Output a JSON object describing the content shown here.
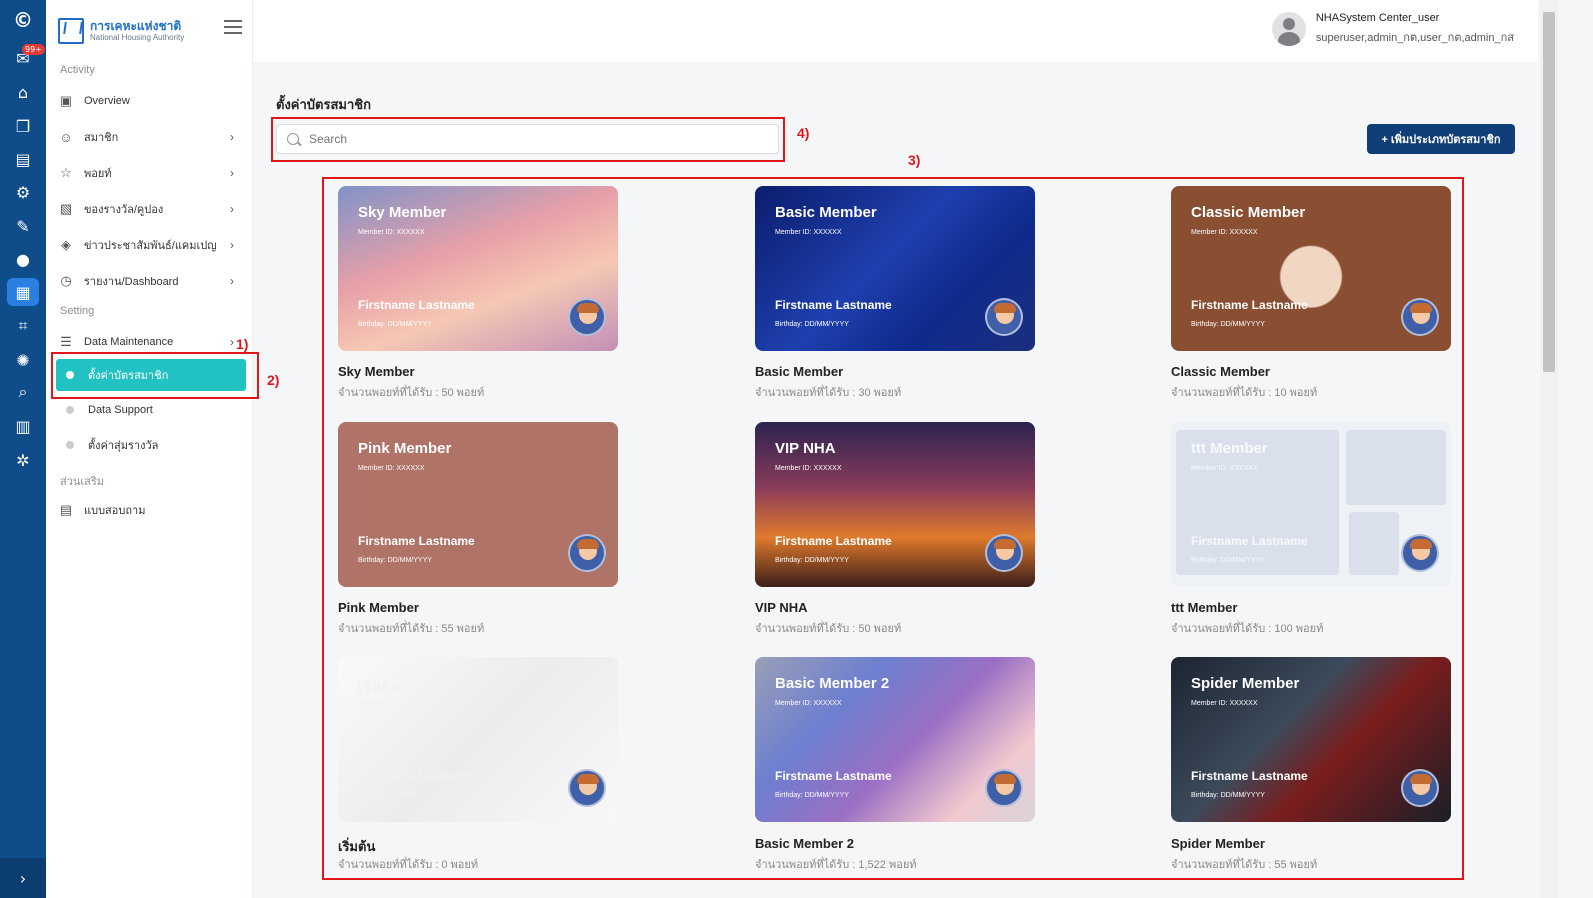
{
  "rail": {
    "badge": "99+",
    "expand_icon": "›"
  },
  "sidebar": {
    "logo_th": "การเคหะแห่งชาติ",
    "logo_en": "National Housing Authority",
    "section_activity": "Activity",
    "items": [
      {
        "label": "Overview"
      },
      {
        "label": "สมาชิก"
      },
      {
        "label": "พอยท์"
      },
      {
        "label": "ของรางวัล/คูปอง"
      },
      {
        "label": "ข่าวประชาสัมพันธ์/แคมเปญ"
      },
      {
        "label": "รายงาน/Dashboard"
      }
    ],
    "section_setting": "Setting",
    "data_maintenance": "Data Maintenance",
    "sub_items": [
      {
        "label": "ตั้งค่าบัตรสมาชิก"
      },
      {
        "label": "Data Support"
      },
      {
        "label": "ตั้งค่าสุ่มรางวัล"
      }
    ],
    "section_extra": "ส่วนเสริม",
    "survey": "แบบสอบถาม"
  },
  "header": {
    "user_name": "NHASystem Center_user",
    "user_roles": "superuser,admin_กต,user_กต,admin_กส"
  },
  "main": {
    "title": "ตั้งค่าบัตรสมาชิก",
    "search_placeholder": "Search",
    "add_button": "+ เพิ่มประเภทบัตรสมาชิก"
  },
  "annotations": [
    "1)",
    "2)",
    "3)",
    "4)"
  ],
  "card_template": {
    "member_id": "Member ID: XXXXXX",
    "name": "Firstname Lastname",
    "birthday": "Birthday: DD/MM/YYYY"
  },
  "cards": [
    {
      "title": "Sky Member",
      "label": "Sky Member",
      "points": "จำนวนพอยท์ที่ได้รับ : 50 พอยท์"
    },
    {
      "title": "Basic Member",
      "label": "Basic Member",
      "points": "จำนวนพอยท์ที่ได้รับ : 30 พอยท์"
    },
    {
      "title": "Classic Member",
      "label": "Classic Member",
      "points": "จำนวนพอยท์ที่ได้รับ : 10 พอยท์"
    },
    {
      "title": "Pink Member",
      "label": "Pink Member",
      "points": "จำนวนพอยท์ที่ได้รับ : 55 พอยท์"
    },
    {
      "title": "VIP NHA",
      "label": "VIP NHA",
      "points": "จำนวนพอยท์ที่ได้รับ : 50 พอยท์"
    },
    {
      "title": "ttt Member",
      "label": "ttt Member",
      "points": "จำนวนพอยท์ที่ได้รับ : 100 พอยท์"
    },
    {
      "title": "เริ่มต้น",
      "label": "เริ่มต้น",
      "points": "จำนวนพอยท์ที่ได้รับ : 0 พอยท์"
    },
    {
      "title": "Basic Member 2",
      "label": "Basic Member 2",
      "points": "จำนวนพอยท์ที่ได้รับ : 1,522 พอยท์"
    },
    {
      "title": "Spider Member",
      "label": "Spider Member",
      "points": "จำนวนพอยท์ที่ได้รับ : 55 พอยท์"
    }
  ],
  "colors": {
    "rail": "#0f4c8a",
    "active_menu": "#22c1c3",
    "primary_button": "#0f3e78",
    "annotation": "#e0161b"
  }
}
